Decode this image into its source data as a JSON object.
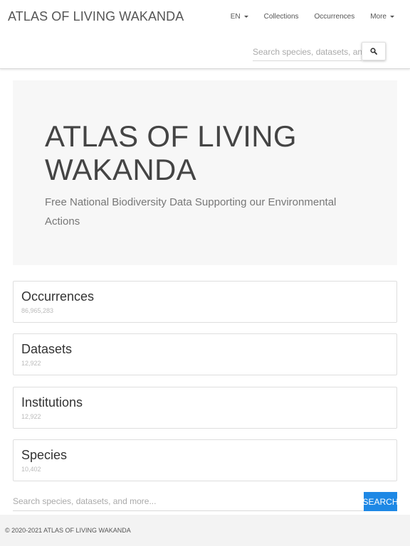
{
  "header": {
    "brand": "ATLAS OF LIVING WAKANDA",
    "nav": [
      {
        "label": "EN",
        "dropdown": true
      },
      {
        "label": "Collections",
        "dropdown": false
      },
      {
        "label": "Occurrences",
        "dropdown": false
      },
      {
        "label": "More",
        "dropdown": true
      }
    ],
    "search": {
      "placeholder": "Search species, datasets, and more...",
      "icon": "search-icon"
    }
  },
  "hero": {
    "title": "ATLAS OF LIVING WAKANDA",
    "subtitle": "Free National Biodiversity Data Supporting our Environmental Actions"
  },
  "stats": [
    {
      "title": "Occurrences",
      "count": "86,965,283"
    },
    {
      "title": "Datasets",
      "count": "12,922"
    },
    {
      "title": "Institutions",
      "count": "12,922"
    },
    {
      "title": "Species",
      "count": "10,402"
    }
  ],
  "main_search": {
    "placeholder": "Search species, datasets, and more...",
    "button": "SEARCH"
  },
  "footer": {
    "text": "© 2020-2021 ATLAS OF LIVING WAKANDA"
  },
  "colors": {
    "accent": "#1e88e5",
    "hero_bg": "#f7f7f7",
    "footer_bg": "#f3f3f3"
  }
}
